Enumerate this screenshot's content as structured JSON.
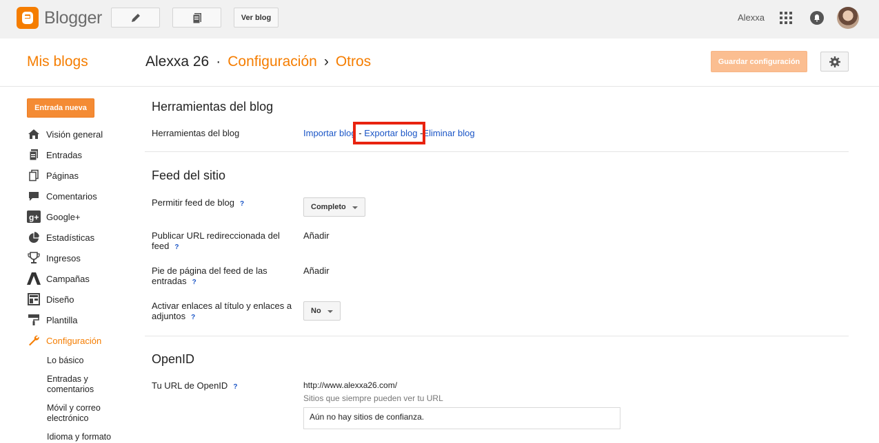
{
  "topbar": {
    "brand": "Blogger",
    "view_blog": "Ver blog",
    "username": "Alexxa"
  },
  "header": {
    "my_blogs": "Mis blogs",
    "blog_name": "Alexxa 26",
    "sep1": "·",
    "crumb_settings": "Configuración",
    "sep2": "›",
    "crumb_other": "Otros",
    "save_label": "Guardar configuración"
  },
  "sidebar": {
    "new_post": "Entrada nueva",
    "items": [
      {
        "label": "Visión general",
        "icon": "home-icon"
      },
      {
        "label": "Entradas",
        "icon": "posts-icon"
      },
      {
        "label": "Páginas",
        "icon": "pages-icon"
      },
      {
        "label": "Comentarios",
        "icon": "comments-icon"
      },
      {
        "label": "Google+",
        "icon": "google-plus-icon"
      },
      {
        "label": "Estadísticas",
        "icon": "stats-icon"
      },
      {
        "label": "Ingresos",
        "icon": "trophy-icon"
      },
      {
        "label": "Campañas",
        "icon": "campaign-icon"
      },
      {
        "label": "Diseño",
        "icon": "layout-icon"
      },
      {
        "label": "Plantilla",
        "icon": "paint-roller-icon"
      },
      {
        "label": "Configuración",
        "icon": "wrench-icon"
      }
    ],
    "subitems": [
      "Lo básico",
      "Entradas y comentarios",
      "Móvil y correo electrónico",
      "Idioma y formato"
    ]
  },
  "main": {
    "tools": {
      "title": "Herramientas del blog",
      "label": "Herramientas del blog",
      "import": "Importar blog",
      "dash": "-",
      "export": "Exportar blog",
      "delete": "Eliminar blog"
    },
    "feed": {
      "title": "Feed del sitio",
      "allow_label": "Permitir feed de blog",
      "allow_value": "Completo",
      "redirect_label": "Publicar URL redireccionada del feed",
      "redirect_action": "Añadir",
      "footer_label": "Pie de página del feed de las entradas",
      "footer_action": "Añadir",
      "links_label": "Activar enlaces al título y enlaces a adjuntos",
      "links_value": "No"
    },
    "openid": {
      "title": "OpenID",
      "url_label": "Tu URL de OpenID",
      "url_value": "http://www.alexxa26.com/",
      "trusted_caption": "Sitios que siempre pueden ver tu URL",
      "trusted_empty": "Aún no hay sitios de confianza."
    },
    "help_mark": "?"
  },
  "colors": {
    "accent": "#f57d00",
    "link": "#1a55c6",
    "highlight": "#e8230f"
  }
}
